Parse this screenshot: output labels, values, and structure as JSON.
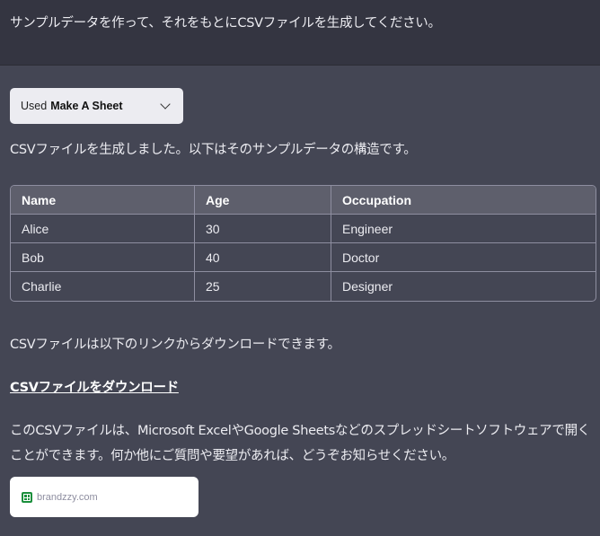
{
  "user_message": "サンプルデータを作って、それをもとにCSVファイルを生成してください。",
  "plugin": {
    "used_label": "Used",
    "name": "Make A Sheet"
  },
  "assistant": {
    "intro": "CSVファイルを生成しました。以下はそのサンプルデータの構造です。",
    "table": {
      "headers": [
        "Name",
        "Age",
        "Occupation"
      ],
      "rows": [
        [
          "Alice",
          "30",
          "Engineer"
        ],
        [
          "Bob",
          "40",
          "Doctor"
        ],
        [
          "Charlie",
          "25",
          "Designer"
        ]
      ]
    },
    "note": "CSVファイルは以下のリンクからダウンロードできます。",
    "download_link": "CSVファイルをダウンロード",
    "closing": "このCSVファイルは、Microsoft ExcelやGoogle Sheetsなどのスプレッドシートソフトウェアで開くことができます。何か他にご質問や要望があれば、どうぞお知らせください。"
  },
  "link_card": {
    "site": "brandzzy.com",
    "icon": "spreadsheet-icon",
    "icon_color": "#1a8f3c"
  },
  "colors": {
    "user_bg": "#343541",
    "assistant_bg": "#444654",
    "table_header_bg": "#5e5f6c"
  }
}
